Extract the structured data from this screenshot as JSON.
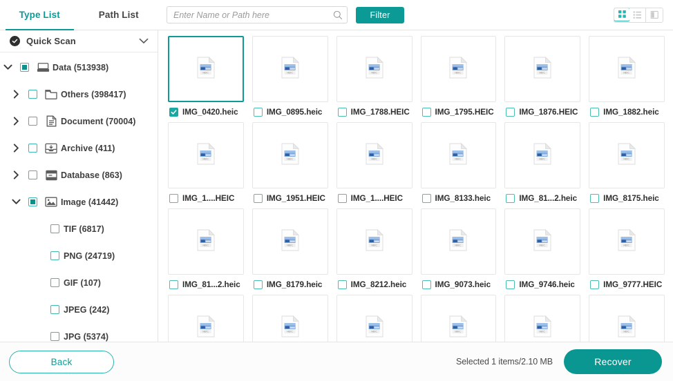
{
  "tabs": [
    {
      "label": "Type List",
      "active": true
    },
    {
      "label": "Path List",
      "active": false
    }
  ],
  "search": {
    "placeholder": "Enter Name or Path here",
    "value": ""
  },
  "toolbar": {
    "filter_label": "Filter",
    "view_modes": [
      {
        "name": "grid-view",
        "active": true
      },
      {
        "name": "list-view",
        "active": false
      },
      {
        "name": "detail-view",
        "active": false
      }
    ]
  },
  "sidebar": {
    "scan": {
      "label": "Quick Scan",
      "expanded": true
    },
    "tree": [
      {
        "label": "Data (513938)",
        "depth": 0,
        "icon": "drive-icon",
        "expanded": true,
        "check": "partial",
        "caret": "down"
      },
      {
        "label": "Others (398417)",
        "depth": 1,
        "icon": "folder-icon",
        "expanded": false,
        "check": "empty",
        "caret": "right"
      },
      {
        "label": "Document (70004)",
        "depth": 1,
        "icon": "document-icon",
        "expanded": false,
        "check": "empty",
        "caret": "right"
      },
      {
        "label": "Archive (411)",
        "depth": 1,
        "icon": "archive-icon",
        "expanded": false,
        "check": "empty",
        "caret": "right"
      },
      {
        "label": "Database (863)",
        "depth": 1,
        "icon": "database-icon",
        "expanded": false,
        "check": "empty",
        "caret": "right"
      },
      {
        "label": "Image (41442)",
        "depth": 1,
        "icon": "image-icon",
        "expanded": true,
        "check": "partial",
        "caret": "down"
      },
      {
        "label": "TIF (6817)",
        "depth": 2,
        "icon": "none",
        "expanded": false,
        "check": "empty",
        "caret": "none"
      },
      {
        "label": "PNG (24719)",
        "depth": 2,
        "icon": "none",
        "expanded": false,
        "check": "empty",
        "caret": "none"
      },
      {
        "label": "GIF (107)",
        "depth": 2,
        "icon": "none",
        "expanded": false,
        "check": "empty",
        "caret": "none"
      },
      {
        "label": "JPEG (242)",
        "depth": 2,
        "icon": "none",
        "expanded": false,
        "check": "empty",
        "caret": "none"
      },
      {
        "label": "JPG (5374)",
        "depth": 2,
        "icon": "none",
        "expanded": false,
        "check": "empty",
        "caret": "none"
      }
    ]
  },
  "files": [
    {
      "name": "IMG_0420.heic",
      "selected": true,
      "type": "HEIC"
    },
    {
      "name": "IMG_0895.heic",
      "selected": false,
      "type": "HEIC"
    },
    {
      "name": "IMG_1788.HEIC",
      "selected": false,
      "type": "HEIC"
    },
    {
      "name": "IMG_1795.HEIC",
      "selected": false,
      "type": "HEIC"
    },
    {
      "name": "IMG_1876.HEIC",
      "selected": false,
      "type": "HEIC"
    },
    {
      "name": "IMG_1882.heic",
      "selected": false,
      "type": "HEIC"
    },
    {
      "name": "IMG_1....HEIC",
      "selected": false,
      "type": "HEIC"
    },
    {
      "name": "IMG_1951.HEIC",
      "selected": false,
      "type": "HEIC"
    },
    {
      "name": "IMG_1....HEIC",
      "selected": false,
      "type": "HEIC"
    },
    {
      "name": "IMG_8133.heic",
      "selected": false,
      "type": "HEIC"
    },
    {
      "name": "IMG_81...2.heic",
      "selected": false,
      "type": "HEIC"
    },
    {
      "name": "IMG_8175.heic",
      "selected": false,
      "type": "HEIC"
    },
    {
      "name": "IMG_81...2.heic",
      "selected": false,
      "type": "HEIC"
    },
    {
      "name": "IMG_8179.heic",
      "selected": false,
      "type": "HEIC"
    },
    {
      "name": "IMG_8212.heic",
      "selected": false,
      "type": "HEIC"
    },
    {
      "name": "IMG_9073.heic",
      "selected": false,
      "type": "HEIC"
    },
    {
      "name": "IMG_9746.heic",
      "selected": false,
      "type": "HEIC"
    },
    {
      "name": "IMG_9777.HEIC",
      "selected": false,
      "type": "HEIC"
    },
    {
      "name": "",
      "selected": false,
      "type": "HEIC"
    },
    {
      "name": "",
      "selected": false,
      "type": "HEIC"
    },
    {
      "name": "",
      "selected": false,
      "type": "HEIC"
    },
    {
      "name": "",
      "selected": false,
      "type": "HEIC"
    },
    {
      "name": "",
      "selected": false,
      "type": "HEIC"
    },
    {
      "name": "",
      "selected": false,
      "type": "HEIC"
    }
  ],
  "footer": {
    "back_label": "Back",
    "status": "Selected 1 items/2.10 MB",
    "recover_label": "Recover"
  },
  "colors": {
    "accent": "#0c9a96",
    "accent_light": "#3fb8b2",
    "text": "#3e3e3e",
    "border": "#e3e3e3"
  }
}
